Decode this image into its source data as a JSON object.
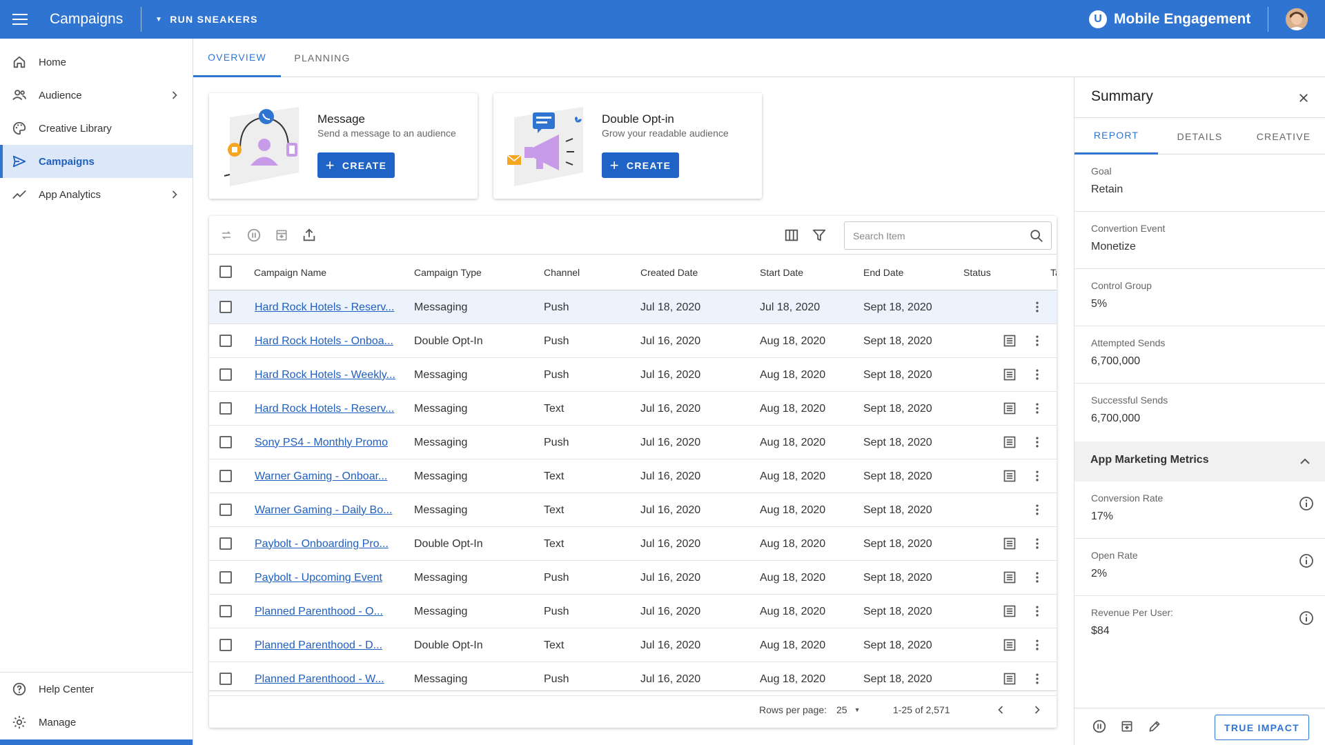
{
  "header": {
    "app_title": "Campaigns",
    "org_name": "RUN SNEAKERS",
    "brand_letter": "U",
    "brand_name": "Mobile Engagement"
  },
  "sidebar": {
    "items": [
      {
        "label": "Home",
        "icon": "home-icon"
      },
      {
        "label": "Audience",
        "icon": "people-icon"
      },
      {
        "label": "Creative Library",
        "icon": "palette-icon"
      },
      {
        "label": "Campaigns",
        "icon": "send-icon",
        "active": true
      },
      {
        "label": "App Analytics",
        "icon": "trending-up-icon"
      }
    ],
    "bottom_items": [
      {
        "label": "Help Center",
        "icon": "help-icon"
      },
      {
        "label": "Manage",
        "icon": "gear-icon"
      }
    ]
  },
  "tabs": [
    {
      "label": "OVERVIEW",
      "active": true
    },
    {
      "label": "PLANNING",
      "active": false
    }
  ],
  "cards": [
    {
      "title": "Message",
      "subtitle": "Send a message to an audience",
      "button": "CREATE"
    },
    {
      "title": "Double Opt-in",
      "subtitle": "Grow your readable audience",
      "button": "CREATE"
    }
  ],
  "table": {
    "search_placeholder": "Search Item",
    "columns": [
      "Campaign Name",
      "Campaign Type",
      "Channel",
      "Created Date",
      "Start Date",
      "End Date",
      "Status",
      "Ta"
    ],
    "rows": [
      {
        "name": "Hard Rock Hotels - Reserv...",
        "type": "Messaging",
        "channel": "Push",
        "created": "Jul 18, 2020",
        "start": "Jul 18, 2020",
        "end": "Sept 18, 2020",
        "report": false,
        "highlight": true
      },
      {
        "name": "Hard Rock Hotels - Onboa...",
        "type": "Double Opt-In",
        "channel": "Push",
        "created": "Jul 16, 2020",
        "start": "Aug 18, 2020",
        "end": "Sept 18, 2020",
        "report": true
      },
      {
        "name": "Hard Rock Hotels - Weekly...",
        "type": "Messaging",
        "channel": "Push",
        "created": "Jul 16, 2020",
        "start": "Aug 18, 2020",
        "end": "Sept 18, 2020",
        "report": true
      },
      {
        "name": "Hard Rock Hotels - Reserv...",
        "type": "Messaging",
        "channel": "Text",
        "created": "Jul 16, 2020",
        "start": "Aug 18, 2020",
        "end": "Sept 18, 2020",
        "report": true
      },
      {
        "name": "Sony PS4 - Monthly Promo",
        "type": "Messaging",
        "channel": "Push",
        "created": "Jul 16, 2020",
        "start": "Aug 18, 2020",
        "end": "Sept 18, 2020",
        "report": true
      },
      {
        "name": "Warner Gaming - Onboar...",
        "type": "Messaging",
        "channel": "Text",
        "created": "Jul 16, 2020",
        "start": "Aug 18, 2020",
        "end": "Sept 18, 2020",
        "report": true
      },
      {
        "name": "Warner Gaming - Daily Bo...",
        "type": "Messaging",
        "channel": "Text",
        "created": "Jul 16, 2020",
        "start": "Aug 18, 2020",
        "end": "Sept 18, 2020",
        "report": false
      },
      {
        "name": "Paybolt - Onboarding Pro...",
        "type": "Double Opt-In",
        "channel": "Text",
        "created": "Jul 16, 2020",
        "start": "Aug 18, 2020",
        "end": "Sept 18, 2020",
        "report": true
      },
      {
        "name": "Paybolt - Upcoming Event",
        "type": "Messaging",
        "channel": "Push",
        "created": "Jul 16, 2020",
        "start": "Aug 18, 2020",
        "end": "Sept 18, 2020",
        "report": true
      },
      {
        "name": "Planned Parenthood - O...",
        "type": "Messaging",
        "channel": "Push",
        "created": "Jul 16, 2020",
        "start": "Aug 18, 2020",
        "end": "Sept 18, 2020",
        "report": true
      },
      {
        "name": "Planned Parenthood - D...",
        "type": "Double Opt-In",
        "channel": "Text",
        "created": "Jul 16, 2020",
        "start": "Aug 18, 2020",
        "end": "Sept 18, 2020",
        "report": true
      },
      {
        "name": "Planned Parenthood - W...",
        "type": "Messaging",
        "channel": "Push",
        "created": "Jul 16, 2020",
        "start": "Aug 18, 2020",
        "end": "Sept 18, 2020",
        "report": true
      }
    ],
    "footer": {
      "rows_per_page_label": "Rows per page:",
      "rows_per_page_value": "25",
      "range": "1-25 of 2,571"
    }
  },
  "summary": {
    "title": "Summary",
    "tabs": [
      {
        "label": "REPORT",
        "active": true
      },
      {
        "label": "DETAILS",
        "active": false
      },
      {
        "label": "CREATIVE",
        "active": false
      }
    ],
    "fields": [
      {
        "label": "Goal",
        "value": "Retain"
      },
      {
        "label": "Convertion Event",
        "value": "Monetize"
      },
      {
        "label": "Control Group",
        "value": "5%"
      },
      {
        "label": "Attempted Sends",
        "value": "6,700,000"
      },
      {
        "label": "Successful Sends",
        "value": "6,700,000"
      }
    ],
    "section_title": "App Marketing Metrics",
    "metrics": [
      {
        "label": "Conversion Rate",
        "value": "17%"
      },
      {
        "label": "Open Rate",
        "value": "2%"
      },
      {
        "label": "Revenue Per User:",
        "value": "$84"
      }
    ],
    "footer_button": "TRUE IMPACT"
  },
  "colors": {
    "primary": "#2f74d0",
    "button": "#1f63c6",
    "link": "#1f5fbf",
    "active_nav_bg": "#dce8f8",
    "row_highlight": "#edf3fc"
  }
}
